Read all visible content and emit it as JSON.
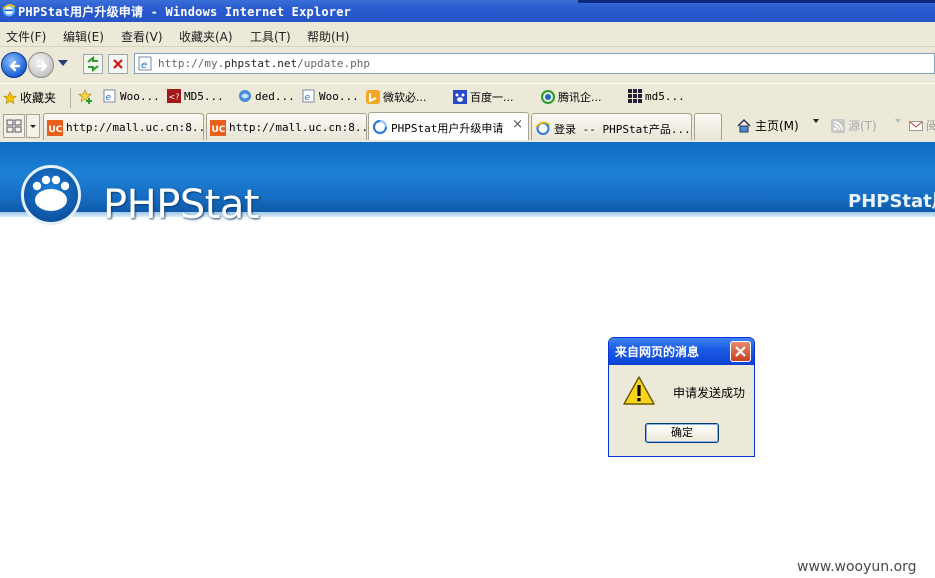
{
  "window": {
    "title": "PHPStat用户升级申请 - Windows Internet Explorer"
  },
  "menu": {
    "items": [
      "文件(F)",
      "编辑(E)",
      "查看(V)",
      "收藏夹(A)",
      "工具(T)",
      "帮助(H)"
    ]
  },
  "address": {
    "url_prefix": "http://my.",
    "url_domain": "phpstat.net",
    "url_path": "/update.php"
  },
  "favorites": {
    "label": "收藏夹",
    "items": [
      "Woo...",
      "MD5...",
      "ded...",
      "Woo...",
      "微软必...",
      "百度一...",
      "腾讯企...",
      "md5..."
    ]
  },
  "tabs": [
    {
      "label": "http://mall.uc.cn:8...",
      "icon": "uc-icon",
      "active": false
    },
    {
      "label": "http://mall.uc.cn:8...",
      "icon": "uc-icon",
      "active": false
    },
    {
      "label": "PHPStat用户升级申请",
      "icon": "loading-icon",
      "active": true
    },
    {
      "label": "登录 -- PHPStat产品...",
      "icon": "ie-page-icon",
      "active": false
    }
  ],
  "commands": {
    "home": "主页(M)",
    "feeds": "源(T)",
    "mail": "阅"
  },
  "banner": {
    "logo_text": "PHPStat",
    "right_text": "PHPStat用"
  },
  "dialog": {
    "title": "来自网页的消息",
    "message": "申请发送成功",
    "ok_label": "确定"
  },
  "watermark": "www.wooyun.org",
  "colors": {
    "titlebar": "#2454c6",
    "chrome": "#ece9d8",
    "banner": "#1d80d4",
    "dialog_title": "#1d5ce6"
  }
}
